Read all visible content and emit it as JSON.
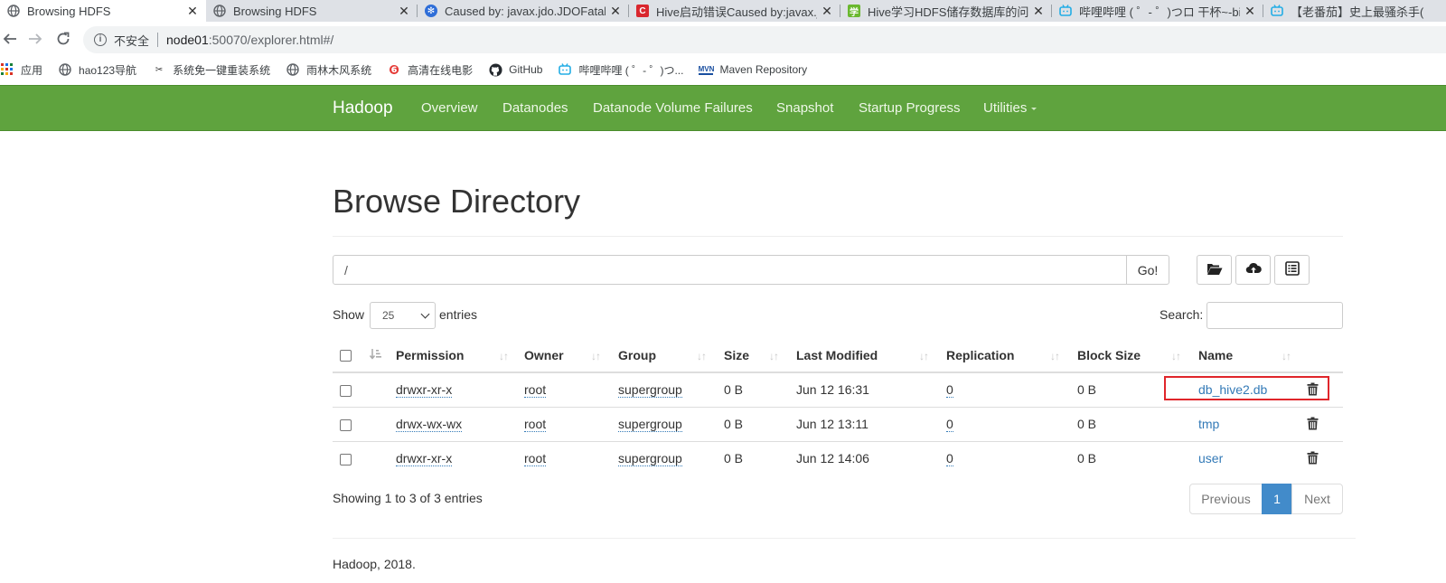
{
  "browser": {
    "tabs": [
      {
        "title": "Browsing HDFS",
        "icon": "globe-icon",
        "active": true
      },
      {
        "title": "Browsing HDFS",
        "icon": "globe-icon",
        "active": false
      },
      {
        "title": "Caused by: javax.jdo.JDOFatalI",
        "icon": "paw-icon",
        "active": false
      },
      {
        "title": "Hive启动错误Caused by:javax.jd",
        "icon": "csdn-icon",
        "active": false
      },
      {
        "title": "Hive学习HDFS储存数据库的问题",
        "icon": "xue-icon",
        "active": false
      },
      {
        "title": "哔哩哔哩 ( ゜- ゜)つロ 干杯~-bilil",
        "icon": "bilibili-icon",
        "active": false
      },
      {
        "title": "【老番茄】史上最骚杀手(",
        "icon": "bilibili-icon",
        "active": false
      }
    ],
    "address": {
      "security_label": "不安全",
      "host": "node01",
      "rest": ":50070/explorer.html#/"
    },
    "bookmarks": [
      {
        "label": "应用",
        "icon": "apps-grid-icon"
      },
      {
        "label": "hao123导航",
        "icon": "globe-icon"
      },
      {
        "label": "系统免一键重装系统",
        "icon": "tools-icon"
      },
      {
        "label": "雨林木风系统",
        "icon": "globe-icon"
      },
      {
        "label": "高清在线电影",
        "icon": "flame-icon"
      },
      {
        "label": "GitHub",
        "icon": "github-icon"
      },
      {
        "label": "哔哩哔哩 ( ゜- ゜)つ...",
        "icon": "bilibili-icon"
      },
      {
        "label": "Maven Repository",
        "icon": "maven-icon"
      }
    ]
  },
  "navbar": {
    "brand": "Hadoop",
    "links": [
      "Overview",
      "Datanodes",
      "Datanode Volume Failures",
      "Snapshot",
      "Startup Progress",
      "Utilities"
    ]
  },
  "page": {
    "title": "Browse Directory",
    "path_value": "/",
    "go_label": "Go!",
    "show_label": "Show",
    "entries_value": "25",
    "entries_label": "entries",
    "search_label": "Search:",
    "columns": [
      "Permission",
      "Owner",
      "Group",
      "Size",
      "Last Modified",
      "Replication",
      "Block Size",
      "Name"
    ],
    "rows": [
      {
        "permission": "drwxr-xr-x",
        "owner": "root",
        "group": "supergroup",
        "size": "0 B",
        "modified": "Jun 12 16:31",
        "replication": "0",
        "block_size": "0 B",
        "name": "db_hive2.db"
      },
      {
        "permission": "drwx-wx-wx",
        "owner": "root",
        "group": "supergroup",
        "size": "0 B",
        "modified": "Jun 12 13:11",
        "replication": "0",
        "block_size": "0 B",
        "name": "tmp"
      },
      {
        "permission": "drwxr-xr-x",
        "owner": "root",
        "group": "supergroup",
        "size": "0 B",
        "modified": "Jun 12 14:06",
        "replication": "0",
        "block_size": "0 B",
        "name": "user"
      }
    ],
    "showing_text": "Showing 1 to 3 of 3 entries",
    "pagination": {
      "previous": "Previous",
      "current": "1",
      "next": "Next"
    },
    "footer": "Hadoop, 2018."
  },
  "colors": {
    "navbar_bg": "#5fa33e",
    "link": "#337ab7",
    "pager_active": "#428bca",
    "highlight_box": "#e0262b"
  }
}
